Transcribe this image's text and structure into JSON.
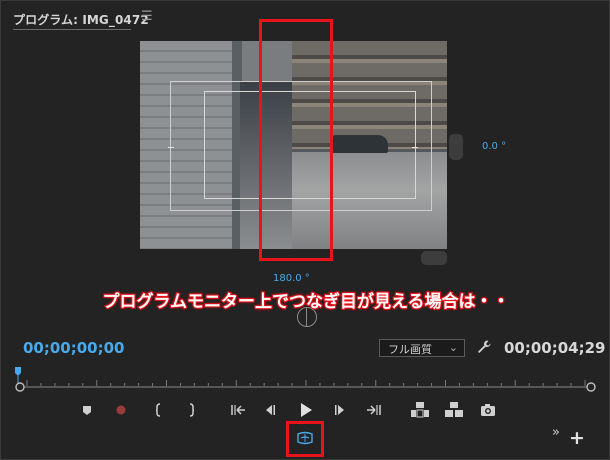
{
  "tab": {
    "title": "プログラム: IMG_0472",
    "menu_icon": "hamburger-icon"
  },
  "viewer": {
    "vertical_angle": "0.0 °",
    "horizontal_angle": "180.0 °"
  },
  "annotation": {
    "caption": "プログラムモニター上でつなぎ目が見える場合は・・",
    "highlight_color": "#e8131b"
  },
  "timecode": {
    "current": "00;00;00;00",
    "duration": "00;00;04;29"
  },
  "quality_select": {
    "value": "フル画質",
    "options": [
      "フル画質"
    ]
  },
  "controls": [
    {
      "name": "add-marker-button",
      "icon": "marker-icon"
    },
    {
      "name": "record-button",
      "icon": "record-icon"
    },
    {
      "name": "mark-in-button",
      "icon": "bracket-left-icon"
    },
    {
      "name": "mark-out-button",
      "icon": "bracket-right-icon"
    },
    {
      "name": "go-to-in-button",
      "icon": "go-to-in-icon"
    },
    {
      "name": "step-back-button",
      "icon": "step-back-icon"
    },
    {
      "name": "play-button",
      "icon": "play-icon"
    },
    {
      "name": "step-forward-button",
      "icon": "step-forward-icon"
    },
    {
      "name": "go-to-out-button",
      "icon": "go-to-out-icon"
    },
    {
      "name": "lift-button",
      "icon": "lift-icon"
    },
    {
      "name": "extract-button",
      "icon": "extract-icon"
    },
    {
      "name": "export-frame-button",
      "icon": "camera-icon"
    }
  ],
  "toggle_vr": {
    "icon": "vr-video-icon",
    "state": "active"
  },
  "colors": {
    "accent_blue": "#4aa9ea",
    "panel_bg": "#232323"
  }
}
